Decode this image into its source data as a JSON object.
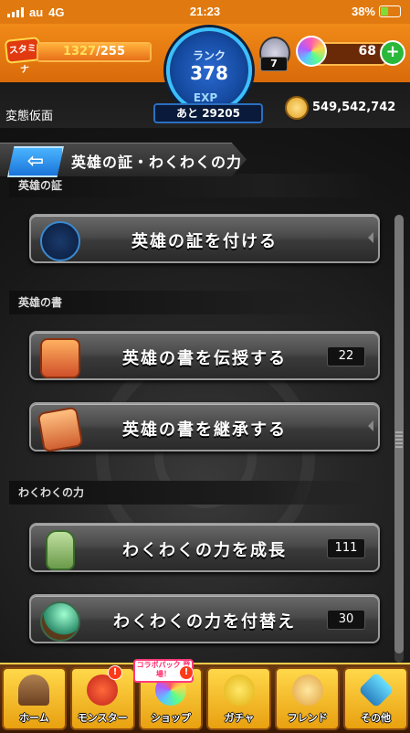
{
  "status_bar": {
    "carrier": "au",
    "network": "4G",
    "time": "21:23",
    "battery": "38%"
  },
  "header": {
    "stamina_label": "スタミナ",
    "stamina_current": "1327",
    "stamina_max": "/255",
    "stamina_fraction": 1.0,
    "rank_label": "ランク",
    "rank_value": "378",
    "exp_label": "EXP",
    "exp_remaining": "あと 29205",
    "badge_count": "7",
    "orb_count": "68",
    "add_orbs_label": "+",
    "player_name": "変態仮面",
    "gold": "549,542,742"
  },
  "title_bar": {
    "back_label": "⇦",
    "title": "英雄の証・わくわくの力"
  },
  "sections": {
    "hero_proof": "英雄の証",
    "hero_book": "英雄の書",
    "waku_power": "わくわくの力"
  },
  "menu": {
    "attach_proof": {
      "label": "英雄の証を付ける",
      "icon": "hero-clover-icon"
    },
    "teach_book": {
      "label": "英雄の書を伝授する",
      "count": "22",
      "icon": "scroll-icon"
    },
    "inherit_book": {
      "label": "英雄の書を継承する",
      "icon": "scroll-transfer-icon"
    },
    "grow_power": {
      "label": "わくわくの力を成長",
      "count": "111",
      "icon": "bottle-icon"
    },
    "swap_power": {
      "label": "わくわくの力を付替え",
      "count": "30",
      "icon": "magnifier-wand-icon"
    }
  },
  "tabs": {
    "home": "ホーム",
    "monster": "モンスター",
    "shop": "ショップ",
    "gacha": "ガチャ",
    "friend": "フレンド",
    "other": "その他",
    "collab_badge": "コラボパック 登場！",
    "alert_mark": "!"
  },
  "colors": {
    "accent_orange": "#e07a10",
    "rank_blue": "#3ac0ff",
    "tab_yellow": "#ffd84a"
  }
}
